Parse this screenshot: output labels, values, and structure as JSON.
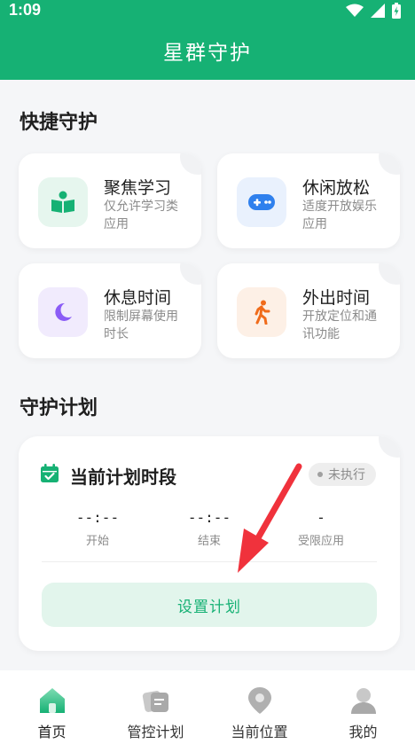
{
  "status_bar": {
    "time": "1:09",
    "icons": [
      "wifi-icon",
      "signal-icon",
      "battery-charging-icon"
    ]
  },
  "header": {
    "title": "星群守护"
  },
  "quick_guard": {
    "title": "快捷守护",
    "cards": [
      {
        "title": "聚焦学习",
        "desc": "仅允许学习类应用",
        "icon": "book-icon",
        "accent": "#16b174",
        "bg": "#e6f6ee"
      },
      {
        "title": "休闲放松",
        "desc": "适度开放娱乐应用",
        "icon": "gamepad-icon",
        "accent": "#2f80ed",
        "bg": "#e9f1fd"
      },
      {
        "title": "休息时间",
        "desc": "限制屏幕使用时长",
        "icon": "moon-icon",
        "accent": "#8b5cf6",
        "bg": "#f1ebfd"
      },
      {
        "title": "外出时间",
        "desc": "开放定位和通讯功能",
        "icon": "walking-icon",
        "accent": "#f06b1a",
        "bg": "#fdf0e6"
      }
    ]
  },
  "guard_plan": {
    "title": "守护计划",
    "card": {
      "heading": "当前计划时段",
      "status": "未执行",
      "columns": [
        {
          "value": "--:--",
          "label": "开始"
        },
        {
          "value": "--:--",
          "label": "结束"
        },
        {
          "value": "-",
          "label": "受限应用"
        }
      ],
      "button": "设置计划"
    }
  },
  "tab_bar": {
    "tabs": [
      {
        "label": "首页",
        "icon": "home-icon",
        "active": true
      },
      {
        "label": "管控计划",
        "icon": "plan-icon",
        "active": false
      },
      {
        "label": "当前位置",
        "icon": "location-icon",
        "active": false
      },
      {
        "label": "我的",
        "icon": "profile-icon",
        "active": false
      }
    ]
  },
  "colors": {
    "brand": "#16b174",
    "arrow": "#f0323c"
  }
}
